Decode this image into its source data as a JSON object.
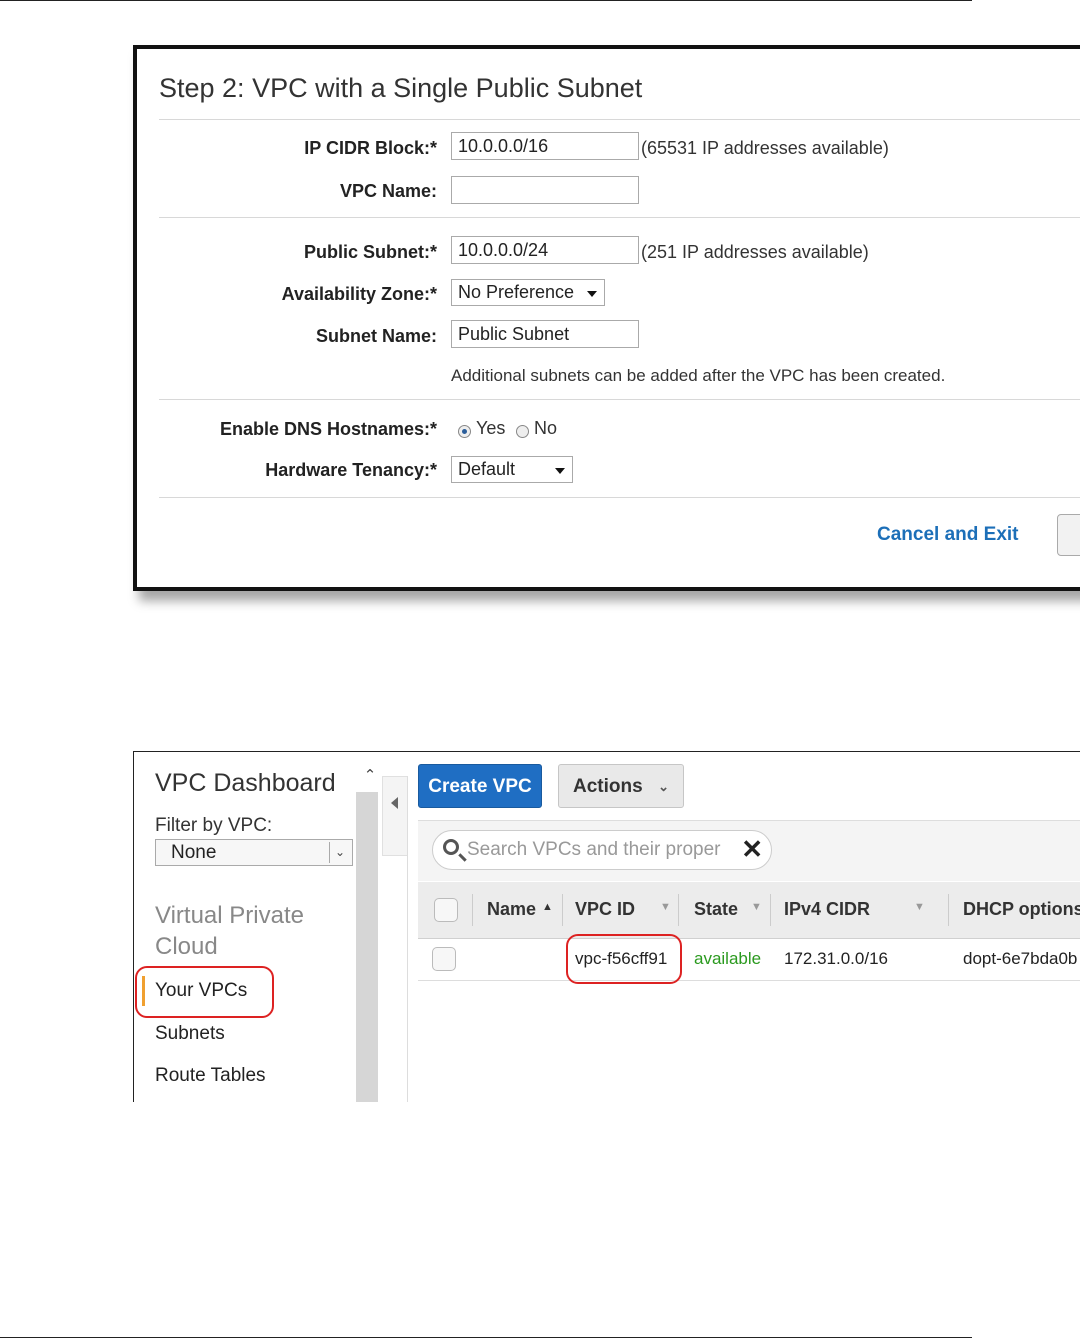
{
  "wizard": {
    "title": "Step 2: VPC with a Single Public Subnet",
    "fields": {
      "ip_cidr_block": {
        "label": "IP CIDR Block:*",
        "value": "10.0.0.0/16",
        "hint": "(65531 IP addresses available)"
      },
      "vpc_name": {
        "label": "VPC Name:",
        "value": ""
      },
      "public_subnet": {
        "label": "Public Subnet:*",
        "value": "10.0.0.0/24",
        "hint": "(251 IP addresses available)"
      },
      "availability_zone": {
        "label": "Availability Zone:*",
        "selected": "No Preference"
      },
      "subnet_name": {
        "label": "Subnet Name:",
        "value": "Public Subnet"
      },
      "subnet_note": "Additional subnets can be added after the VPC has been created.",
      "enable_dns_hostnames": {
        "label": "Enable DNS Hostnames:*",
        "options": [
          "Yes",
          "No"
        ],
        "selected": "Yes"
      },
      "hardware_tenancy": {
        "label": "Hardware Tenancy:*",
        "selected": "Default"
      }
    },
    "cancel_label": "Cancel and Exit"
  },
  "console": {
    "sidebar": {
      "title": "VPC Dashboard",
      "filter_label": "Filter by VPC:",
      "filter_value": "None",
      "section_heading_line1": "Virtual Private",
      "section_heading_line2": "Cloud",
      "items": [
        {
          "label": "Your VPCs",
          "active": true
        },
        {
          "label": "Subnets"
        },
        {
          "label": "Route Tables"
        }
      ],
      "active_accent_color": "#f0a030"
    },
    "toolbar": {
      "create_label": "Create VPC",
      "actions_label": "Actions",
      "create_color": "#1f6ec3"
    },
    "search": {
      "placeholder": "Search VPCs and their proper"
    },
    "table": {
      "columns": [
        "Name",
        "VPC ID",
        "State",
        "IPv4 CIDR",
        "DHCP options"
      ],
      "rows": [
        {
          "name": "",
          "vpc_id": "vpc-f56cff91",
          "state": "available",
          "ipv4_cidr": "172.31.0.0/16",
          "dhcp_options": "dopt-6e7bda0b"
        }
      ],
      "state_color": "#2b9a1f"
    },
    "highlight_color": "#d22222"
  }
}
